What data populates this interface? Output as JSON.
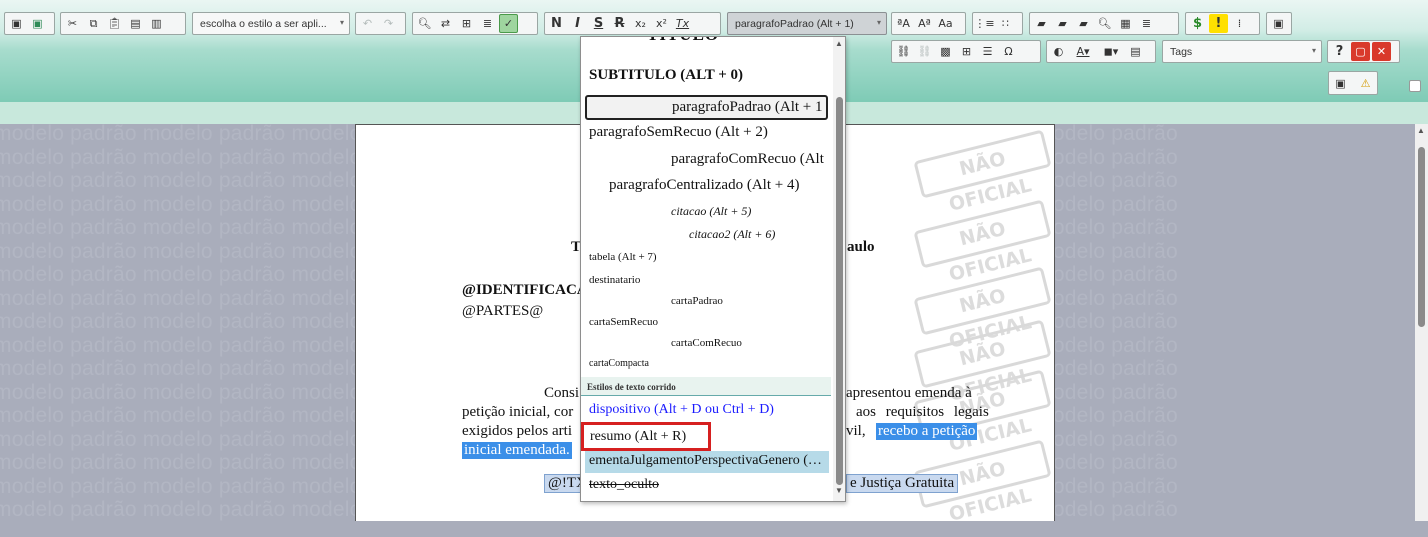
{
  "toolbar": {
    "style_combo": "escolha o estilo a ser apli...",
    "paragraph_combo": "paragrafoPadrao (Alt + 1)",
    "tags_combo": "Tags",
    "bold": "N",
    "italic": "I",
    "strike": "S",
    "r_btn": "R",
    "sub": "x₂",
    "sup": "x²",
    "tx": "Tx",
    "help": "?",
    "colors": {
      "save_green": "#2e8b57",
      "highlight_yellow": "#ffe000",
      "dollar_green": "#2a8a2a",
      "close_red": "#d9392b"
    }
  },
  "dropdown": {
    "items": [
      {
        "label": "TITULO"
      },
      {
        "label": "SUBTITULO (ALT + 0)"
      },
      {
        "label": "paragrafoPadrao (Alt + 1"
      },
      {
        "label": "paragrafoSemRecuo (Alt + 2)"
      },
      {
        "label": "paragrafoComRecuo (Alt"
      },
      {
        "label": "paragrafoCentralizado (Alt + 4)"
      },
      {
        "label": "citacao (Alt + 5)"
      },
      {
        "label": "citacao2 (Alt + 6)"
      },
      {
        "label": "tabela (Alt + 7)"
      },
      {
        "label": "destinatario"
      },
      {
        "label": "cartaPadrao"
      },
      {
        "label": "cartaSemRecuo"
      },
      {
        "label": "cartaComRecuo"
      },
      {
        "label": "cartaCompacta"
      }
    ],
    "section_header": "Estilos de texto corrido",
    "inline_items": [
      {
        "label": "dispositivo (Alt + D ou Ctrl + D)"
      },
      {
        "label": "resumo (Alt + R)"
      },
      {
        "label": "ementaJulgamentoPerspectivaGenero (…"
      },
      {
        "label": "texto_oculto"
      }
    ]
  },
  "document": {
    "watermark_text": "modelo padrão modelo padrão modelo padrão modelo padrão modelo padrão modelo padrão modelo padrão modelo padrão",
    "stamp_text": "NÃO OFICIAL",
    "header_t": "T",
    "header_suffix": "aulo",
    "identificacao": "@IDENTIFICACA",
    "partes": "@PARTES@",
    "para_line1_left": "Consi",
    "para_line1_right": "apresentou emenda à",
    "para_line2_left": "petição inicial, cor",
    "para_line2_right": "aos requisitos legais",
    "para_line3_left": "exigidos pelos arti",
    "para_line3_mid": "vil,",
    "para_line3_sel": "recebo a petição",
    "para_line4_sel": "inicial emendada.",
    "tx_left": "@!TX",
    "tx_right": "e Justiça Gratuita"
  }
}
